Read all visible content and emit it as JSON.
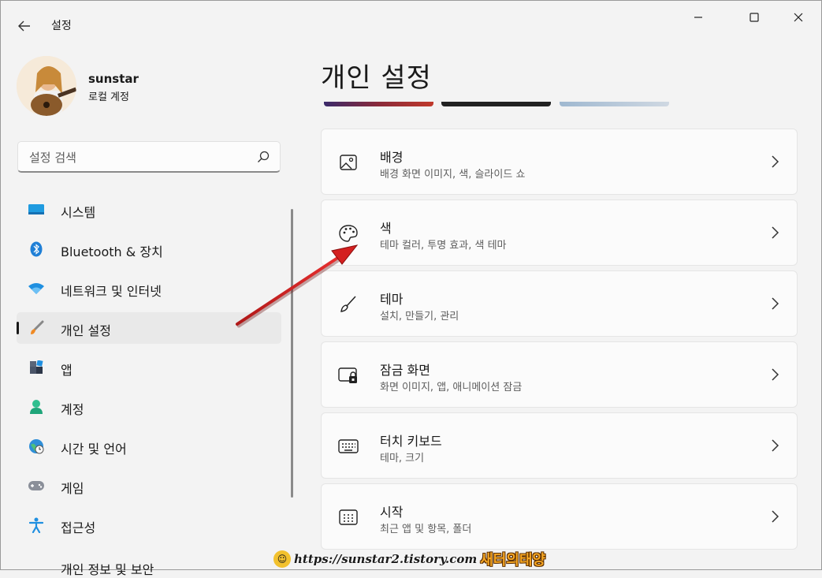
{
  "window": {
    "title": "설정"
  },
  "user": {
    "name": "sunstar",
    "account_type": "로컬 계정"
  },
  "search": {
    "placeholder": "설정 검색"
  },
  "nav": {
    "items": [
      {
        "label": "시스템",
        "icon": "system-display-icon"
      },
      {
        "label": "Bluetooth & 장치",
        "icon": "bluetooth-icon"
      },
      {
        "label": "네트워크 및 인터넷",
        "icon": "wifi-icon"
      },
      {
        "label": "개인 설정",
        "icon": "brush-icon",
        "active": true
      },
      {
        "label": "앱",
        "icon": "apps-icon"
      },
      {
        "label": "계정",
        "icon": "account-icon"
      },
      {
        "label": "시간 및 언어",
        "icon": "globe-clock-icon"
      },
      {
        "label": "게임",
        "icon": "gamepad-icon"
      },
      {
        "label": "접근성",
        "icon": "accessibility-icon"
      }
    ],
    "partial_item": "개인 정보 및 보안"
  },
  "main": {
    "title": "개인 설정",
    "cards": [
      {
        "title": "배경",
        "subtitle": "배경 화면 이미지, 색, 슬라이드 쇼",
        "icon": "image-icon"
      },
      {
        "title": "색",
        "subtitle": "테마 컬러, 투명 효과, 색 테마",
        "icon": "palette-icon"
      },
      {
        "title": "테마",
        "subtitle": "설치, 만들기, 관리",
        "icon": "brush-icon"
      },
      {
        "title": "잠금 화면",
        "subtitle": "화면 이미지, 앱, 애니메이션 잠금",
        "icon": "lock-screen-icon"
      },
      {
        "title": "터치 키보드",
        "subtitle": "테마, 크기",
        "icon": "keyboard-icon"
      },
      {
        "title": "시작",
        "subtitle": "최근 앱 및 항목, 폴더",
        "icon": "start-menu-icon"
      }
    ]
  },
  "watermark": {
    "url": "https://sunstar2.tistory.com",
    "brand": "새터의태양"
  },
  "colors": {
    "accent": "#0067c0",
    "annotation_arrow": "#d42020",
    "window_bg": "#f3f3f3",
    "card_bg": "#fbfbfb"
  }
}
